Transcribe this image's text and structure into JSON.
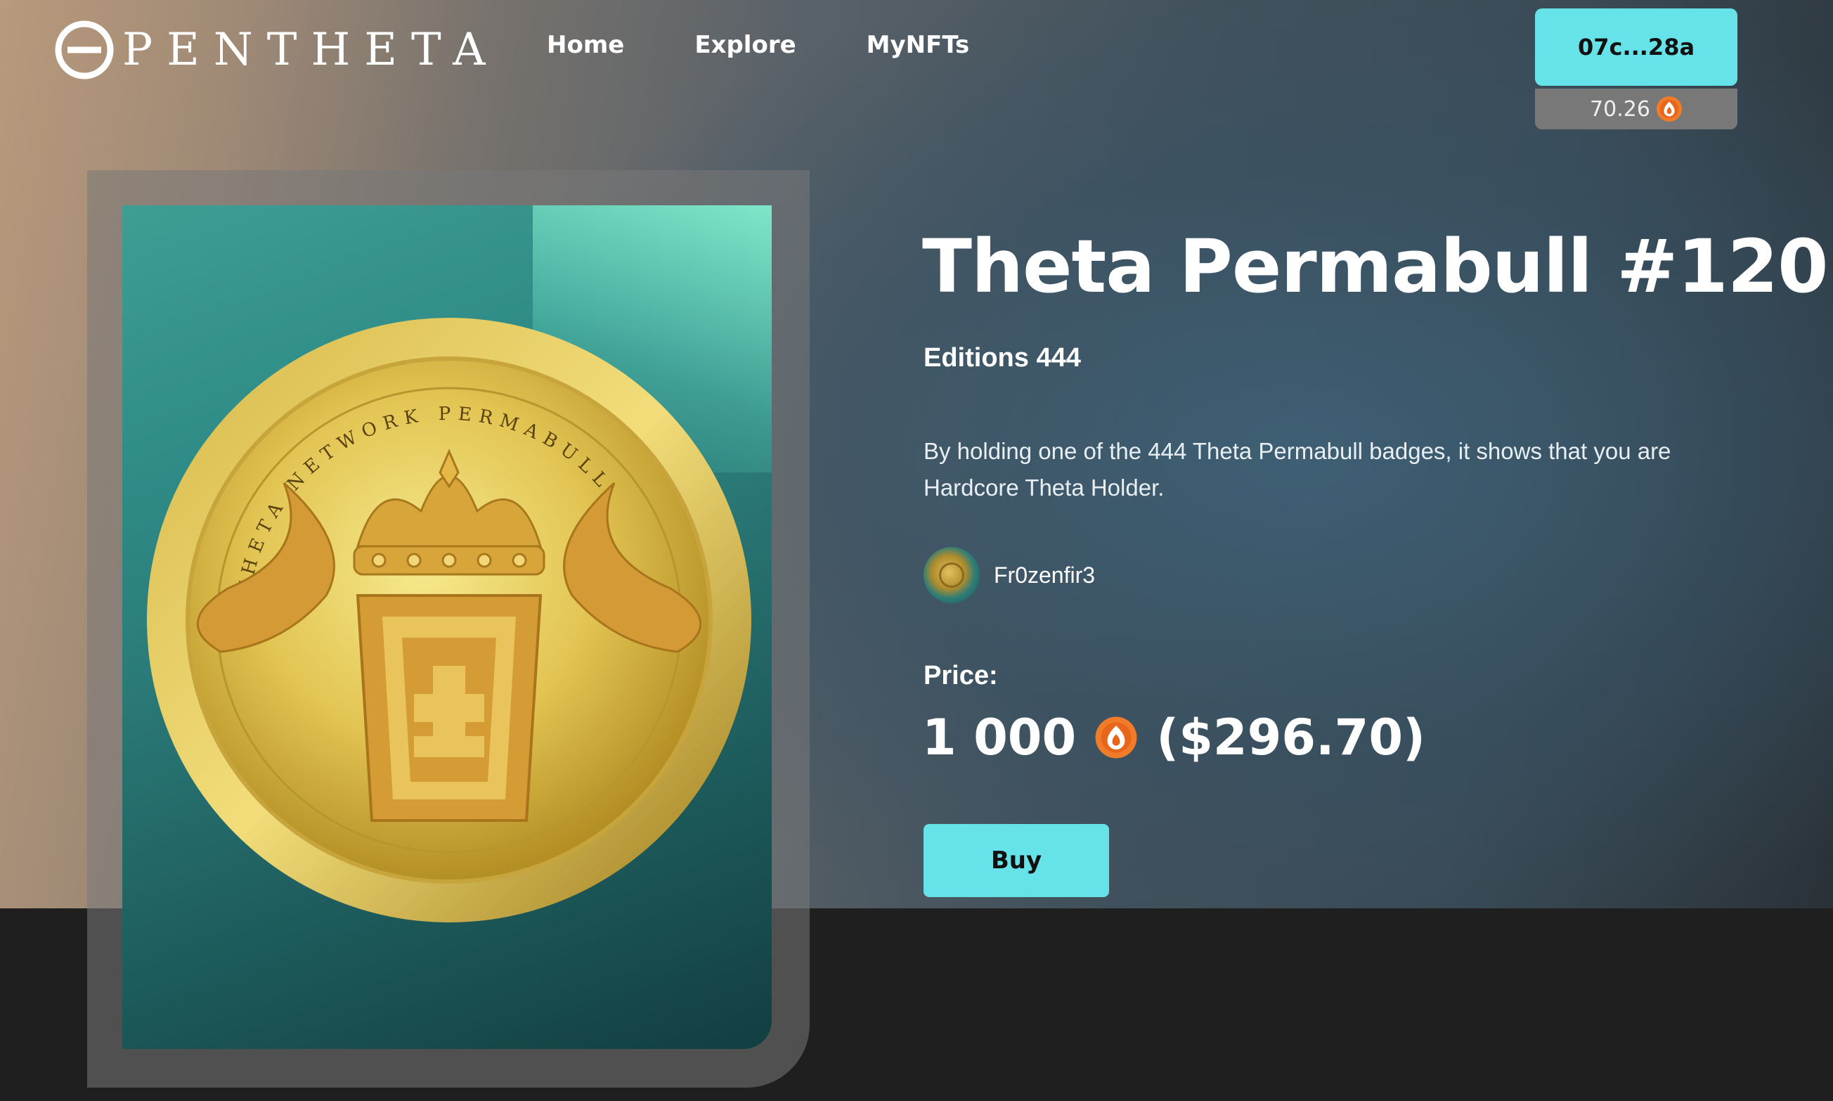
{
  "header": {
    "logo_text": "PENTHETA",
    "nav": [
      {
        "label": "Home"
      },
      {
        "label": "Explore"
      },
      {
        "label": "MyNFTs"
      }
    ],
    "wallet": {
      "address": "07c...28a",
      "balance": "70.26",
      "balance_icon": "tfuel-icon"
    }
  },
  "nft": {
    "title": "Theta Permabull #120",
    "editions": "Editions 444",
    "description": "By holding one of the 444 Theta Permabull badges, it shows that you are Hardcore Theta Holder.",
    "coin_inscription": "THETA NETWORK PERMABULL",
    "creator": {
      "name": "Fr0zenfir3"
    },
    "price_label": "Price:",
    "price_amount": "1 000",
    "price_icon": "tfuel-icon",
    "price_usd": "($296.70)",
    "buy_label": "Buy"
  },
  "colors": {
    "accent": "#66e3e8",
    "tfuel": "#f07c2a",
    "footer_bg": "#1f1f1f"
  }
}
